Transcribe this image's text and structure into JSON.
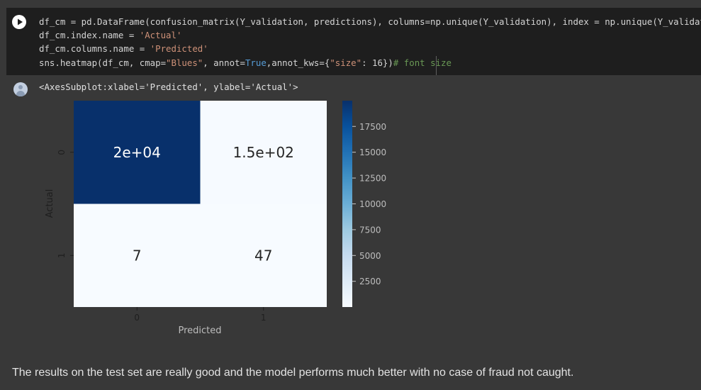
{
  "code_cell": {
    "run_label": "Run cell",
    "lines": [
      [
        {
          "t": "df_cm = pd.DataFrame(confusion_matrix(Y_validation, predictions), columns=np.unique(Y_validation), index = np.unique(Y_validation))",
          "c": ""
        }
      ],
      [
        {
          "t": "df_cm.index.name = ",
          "c": ""
        },
        {
          "t": "'Actual'",
          "c": "str"
        }
      ],
      [
        {
          "t": "df_cm.columns.name = ",
          "c": ""
        },
        {
          "t": "'Predicted'",
          "c": "str"
        }
      ],
      [
        {
          "t": "sns.heatmap(df_cm, cmap=",
          "c": ""
        },
        {
          "t": "\"Blues\"",
          "c": "str"
        },
        {
          "t": ", annot=",
          "c": ""
        },
        {
          "t": "True",
          "c": "kw"
        },
        {
          "t": ",annot_kws={",
          "c": ""
        },
        {
          "t": "\"size\"",
          "c": "str"
        },
        {
          "t": ": 16})",
          "c": ""
        },
        {
          "t": "# font size",
          "c": "cm"
        }
      ]
    ]
  },
  "output": {
    "repr": "<AxesSubplot:xlabel='Predicted', ylabel='Actual'>"
  },
  "chart_data": {
    "type": "heatmap",
    "xlabel": "Predicted",
    "ylabel": "Actual",
    "x_categories": [
      "0",
      "1"
    ],
    "y_categories": [
      "0",
      "1"
    ],
    "values": [
      [
        19990,
        150
      ],
      [
        7,
        47
      ]
    ],
    "annotations": [
      [
        "2e+04",
        "1.5e+02"
      ],
      [
        "7",
        "47"
      ]
    ],
    "cmap": "Blues",
    "colorbar": {
      "ticks": [
        2500,
        5000,
        7500,
        10000,
        12500,
        15000,
        17500
      ],
      "tick_labels": [
        "2500",
        "5000",
        "7500",
        "10000",
        "12500",
        "15000",
        "17500"
      ],
      "range": [
        7,
        19990
      ]
    },
    "colors": {
      "low": "#f7fbff",
      "high": "#08306b",
      "text_dark_cell": "#ffffff",
      "text_light_cell": "#262626"
    }
  },
  "note_text": "The results on the test set are really good and the model performs much better with no case of fraud not caught."
}
